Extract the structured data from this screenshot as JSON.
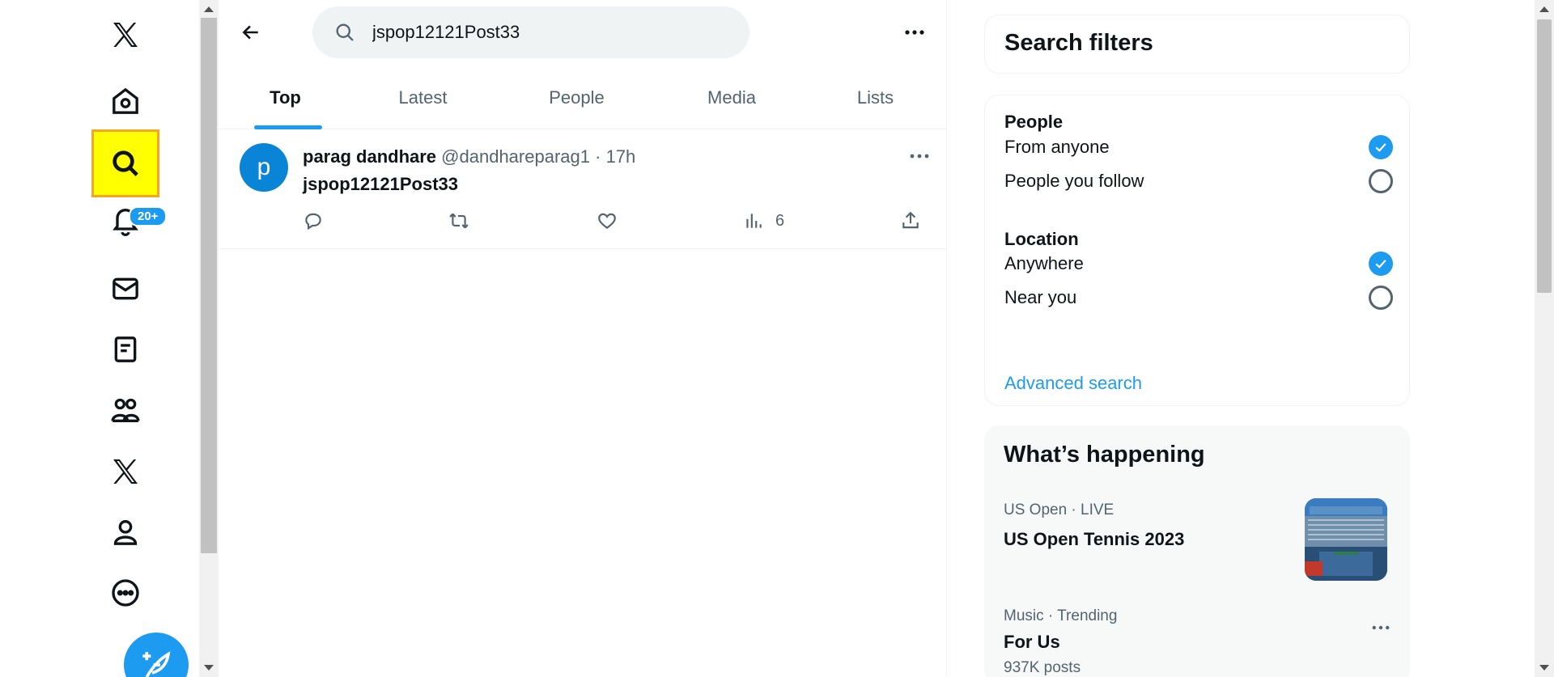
{
  "nav": {
    "items": [
      {
        "name": "x-logo-icon",
        "label": "X"
      },
      {
        "name": "home-icon",
        "label": "Home"
      },
      {
        "name": "search-icon",
        "label": "Explore"
      },
      {
        "name": "bell-icon",
        "label": "Notifications"
      },
      {
        "name": "mail-icon",
        "label": "Messages"
      },
      {
        "name": "lists-icon",
        "label": "Lists"
      },
      {
        "name": "communities-icon",
        "label": "Communities"
      },
      {
        "name": "premium-x-icon",
        "label": "Premium"
      },
      {
        "name": "profile-icon",
        "label": "Profile"
      },
      {
        "name": "more-icon",
        "label": "More"
      }
    ],
    "notification_badge": "20+",
    "accent_color": "#1d9bf0",
    "highlight_color": "#ffff00"
  },
  "search": {
    "query": "jspop12121Post33"
  },
  "tabs": [
    {
      "label": "Top",
      "active": true
    },
    {
      "label": "Latest",
      "active": false
    },
    {
      "label": "People",
      "active": false
    },
    {
      "label": "Media",
      "active": false
    },
    {
      "label": "Lists",
      "active": false
    }
  ],
  "post": {
    "avatar_letter": "p",
    "author_name": "parag dandhare",
    "handle": "@dandhareparag1",
    "separator": "·",
    "time": "17h",
    "text": "jspop12121Post33",
    "views": "6"
  },
  "filters": {
    "title": "Search filters",
    "people_heading": "People",
    "people_options": [
      {
        "label": "From anyone",
        "checked": true
      },
      {
        "label": "People you follow",
        "checked": false
      }
    ],
    "location_heading": "Location",
    "location_options": [
      {
        "label": "Anywhere",
        "checked": true
      },
      {
        "label": "Near you",
        "checked": false
      }
    ],
    "advanced_link": "Advanced search"
  },
  "whats_happening": {
    "title": "What’s happening",
    "trends": [
      {
        "meta": "US Open · LIVE",
        "title": "US Open Tennis 2023",
        "count": ""
      },
      {
        "meta": "Music · Trending",
        "title": "For Us",
        "count": "937K posts"
      }
    ]
  }
}
